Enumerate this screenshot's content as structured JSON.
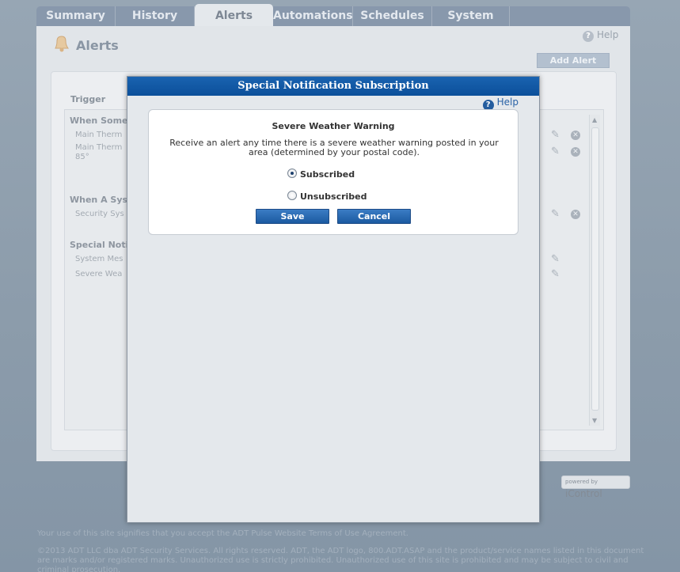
{
  "tabs": [
    "Summary",
    "History",
    "Alerts",
    "Automations",
    "Schedules",
    "System"
  ],
  "active_tab": "Alerts",
  "page": {
    "title": "Alerts",
    "help_label": "Help",
    "add_alert_label": "Add Alert",
    "trigger_header": "Trigger",
    "groups": [
      {
        "label": "When Somet"
      },
      {
        "label": "When A Syst"
      },
      {
        "label": "Special Notifi"
      }
    ],
    "items": [
      {
        "label": "Main Therm"
      },
      {
        "label": "Main Therm"
      },
      {
        "label": "85°"
      },
      {
        "label": "Security Sys"
      },
      {
        "label": "System Mes"
      },
      {
        "label": "Severe Wea"
      }
    ]
  },
  "powered_by": {
    "prefix": "powered by",
    "brand": "iControl"
  },
  "footer": {
    "terms": "Your use of this site signifies that you accept the ADT Pulse Website Terms of Use Agreement.",
    "copyright": "©2013 ADT LLC dba ADT Security Services. All rights reserved. ADT, the ADT logo, 800.ADT.ASAP and the product/service names listed in this document are marks and/or registered marks. Unauthorized use is strictly prohibited. Unauthorized use of this site is prohibited and may be subject to civil and criminal prosecution."
  },
  "modal": {
    "title": "Special Notification Subscription",
    "help_label": "Help",
    "card_title": "Severe Weather Warning",
    "description": "Receive an alert any time there is a severe weather warning posted in your area (determined by your postal code).",
    "options": [
      {
        "label": "Subscribed",
        "selected": true
      },
      {
        "label": "Unsubscribed",
        "selected": false
      }
    ],
    "save_label": "Save",
    "cancel_label": "Cancel"
  },
  "colors": {
    "modal_header": "#0b4f9a",
    "button": "#1b5aa1",
    "background": "#8c9cab"
  }
}
